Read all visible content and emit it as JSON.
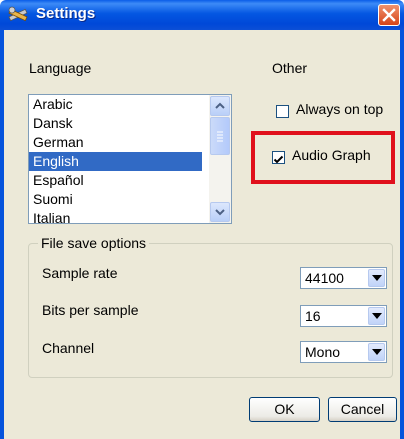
{
  "window": {
    "title": "Settings",
    "icon": "settings-tools-icon",
    "close_icon": "close-icon"
  },
  "language": {
    "label": "Language",
    "items": [
      "Arabic",
      "Dansk",
      "German",
      "English",
      "Español",
      "Suomi",
      "Italian"
    ],
    "selected": "English"
  },
  "other": {
    "label": "Other",
    "always_on_top": {
      "label": "Always on top",
      "checked": false
    },
    "audio_graph": {
      "label": "Audio Graph",
      "checked": true
    }
  },
  "file_save": {
    "legend": "File save options",
    "sample_rate": {
      "label": "Sample rate",
      "value": "44100"
    },
    "bits_per_sample": {
      "label": "Bits per sample",
      "value": "16"
    },
    "channel": {
      "label": "Channel",
      "value": "Mono"
    }
  },
  "buttons": {
    "ok": "OK",
    "cancel": "Cancel"
  },
  "colors": {
    "highlight": "#e0101c",
    "selection": "#316ac5",
    "titlebar": "#0457e2"
  }
}
